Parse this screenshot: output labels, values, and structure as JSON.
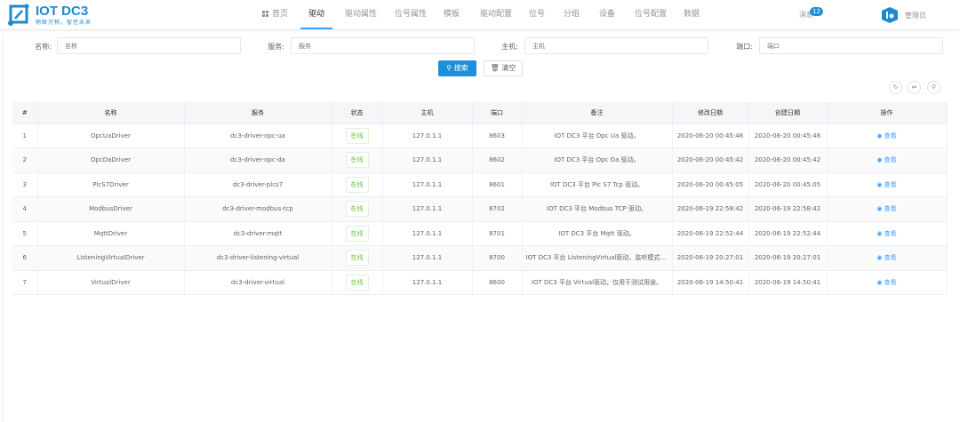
{
  "header": {
    "logo_title": "IOT DC3",
    "logo_sub": "物联万物，智控未来",
    "nav": [
      {
        "label": "首页",
        "icon": "grid-icon"
      },
      {
        "label": "驱动",
        "active": true
      },
      {
        "label": "驱动属性"
      },
      {
        "label": "位号属性"
      },
      {
        "label": "模板"
      },
      {
        "label": "驱动配置"
      },
      {
        "label": "位号"
      },
      {
        "label": "分组"
      },
      {
        "label": "设备"
      },
      {
        "label": "位号配置"
      },
      {
        "label": "数据"
      }
    ],
    "messages_label": "消息",
    "messages_count": "12",
    "user_label": "管理员"
  },
  "search": {
    "fields": [
      {
        "label": "名称:",
        "placeholder": "名称"
      },
      {
        "label": "服务:",
        "placeholder": "服务"
      },
      {
        "label": "主机:",
        "placeholder": "主机"
      },
      {
        "label": "端口:",
        "placeholder": "端口"
      }
    ],
    "search_button": "搜索",
    "reset_button": "清空"
  },
  "toolbar": {
    "icons": [
      "refresh-icon",
      "column-settings-icon",
      "search-toggle-icon"
    ]
  },
  "table": {
    "columns": [
      "#",
      "名称",
      "服务",
      "状态",
      "主机",
      "端口",
      "备注",
      "修改日期",
      "创建日期",
      "操作"
    ],
    "rows": [
      [
        "1",
        "OpcUaDriver",
        "dc3-driver-opc-ua",
        "在线",
        "127.0.1.1",
        "8603",
        "IOT DC3 平台 Opc Ua 驱动。",
        "2020-06-20 00:45:46",
        "2020-06-20 00:45:46",
        "查看"
      ],
      [
        "2",
        "OpcDaDriver",
        "dc3-driver-opc-da",
        "在线",
        "127.0.1.1",
        "8602",
        "IOT DC3 平台 Opc Da 驱动。",
        "2020-06-20 00:45:42",
        "2020-06-20 00:45:42",
        "查看"
      ],
      [
        "3",
        "PlcS7Driver",
        "dc3-driver-plcs7",
        "在线",
        "127.0.1.1",
        "8601",
        "IOT DC3 平台 Plc S7 Tcp 驱动。",
        "2020-06-20 00:45:05",
        "2020-06-20 00:45:05",
        "查看"
      ],
      [
        "4",
        "ModbusDriver",
        "dc3-driver-modbus-tcp",
        "在线",
        "127.0.1.1",
        "8702",
        "IOT DC3 平台 Modbus TCP 驱动。",
        "2020-06-19 22:58:42",
        "2020-06-19 22:58:42",
        "查看"
      ],
      [
        "5",
        "MqttDriver",
        "dc3-driver-mqtt",
        "在线",
        "127.0.1.1",
        "8701",
        "IOT DC3 平台 Mqtt 驱动。",
        "2020-06-19 22:52:44",
        "2020-06-19 22:52:44",
        "查看"
      ],
      [
        "6",
        "ListeningVirtualDriver",
        "dc3-driver-listening-virtual",
        "在线",
        "127.0.1.1",
        "8700",
        "IOT DC3 平台 ListeningVirtual驱动，监听模式，...",
        "2020-06-19 20:27:01",
        "2020-06-19 20:27:01",
        "查看"
      ],
      [
        "7",
        "VirtualDriver",
        "dc3-driver-virtual",
        "在线",
        "127.0.1.1",
        "8600",
        "IOT DC3 平台 Virtual驱动，仅用于测试用途。",
        "2020-06-19 14:50:41",
        "2020-06-19 14:50:41",
        "查看"
      ]
    ]
  },
  "colors": {
    "primary": "#1e8fd8",
    "online": "#67c23a",
    "link": "#409eff"
  }
}
